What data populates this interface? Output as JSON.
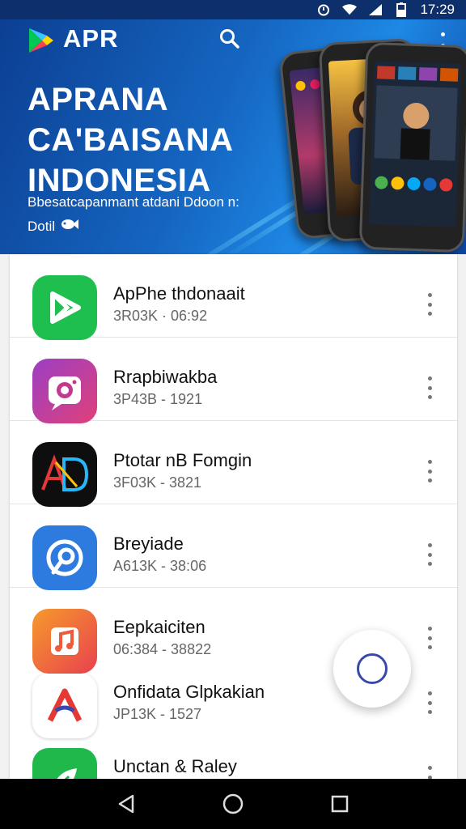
{
  "status_bar": {
    "time": "17:29",
    "icons": [
      "alarm-icon",
      "wifi-icon",
      "signal-icon",
      "battery-icon"
    ]
  },
  "app_bar": {
    "brand": "APR",
    "logo_icon": "play-triangle-logo",
    "actions": [
      "search-icon",
      "overflow-menu-icon"
    ]
  },
  "hero": {
    "title_lines": [
      "APRANA",
      "CA'BAISANA",
      "INDONESIA"
    ],
    "subtitle": "Bbesatcapanmant atdani Ddoon n:",
    "cta_label": "Dotil",
    "cta_icon": "fish-icon"
  },
  "apps": [
    {
      "name": "ApPhe thdonaait",
      "meta": "3R03K · 06:92",
      "icon": "play-icon",
      "bg": "#1fbf4f"
    },
    {
      "name": "Rrapbiwakba",
      "meta": "3P43B - 1921",
      "icon": "camera-icon",
      "bg": "#b23fb2"
    },
    {
      "name": "Ptotar nB Fomgin",
      "meta": "3F03K - 3821",
      "icon": "ad-logo-icon",
      "bg": "#0e0e0e"
    },
    {
      "name": "Breyiade",
      "meta": "A613K - 38:06",
      "icon": "pin-circle-icon",
      "bg": "#2e7be0"
    },
    {
      "name": "Eepkaiciten",
      "meta": "06:384 - 38822",
      "icon": "music-note-icon",
      "bg": "#f26b3a"
    },
    {
      "name": "Onfidata Glpkakian",
      "meta": "JP13K - 1527",
      "icon": "letter-a-icon",
      "bg": "#ffffff"
    },
    {
      "name": "Unctan & Raley",
      "meta": "",
      "icon": "leaf-icon",
      "bg": "#1fb84a"
    }
  ],
  "fab": {
    "icon": "circle-icon",
    "accent": "#3949ab"
  },
  "nav": [
    "back-icon",
    "home-icon",
    "recents-icon"
  ],
  "colors": {
    "status_bar": "#0d2f6b",
    "hero_primary": "#1565c0",
    "list_bg": "#ffffff"
  }
}
